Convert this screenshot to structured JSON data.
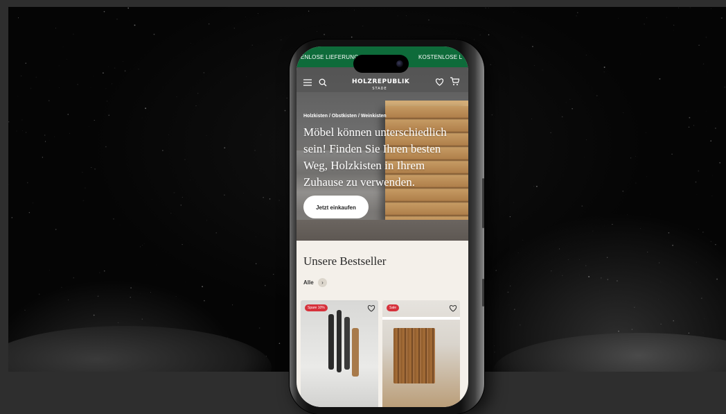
{
  "promo_bar": {
    "left_text": "ENLOSE LIEFERUNG",
    "right_text": "KOSTENLOSE L",
    "color": "#0e6b3a"
  },
  "header": {
    "logo_text": "HOLZREPUBLIK",
    "logo_sub": "STADE",
    "icons": [
      "menu-icon",
      "search-icon",
      "heart-icon",
      "cart-icon"
    ]
  },
  "hero": {
    "breadcrumb": "Holzkisten / Obstkisten / Weinkisten",
    "headline": "Möbel können unterschiedlich sein! Finden Sie Ihren besten Weg, Holzkisten in Ihrem Zuhause zu verwenden.",
    "cta_label": "Jetzt einkaufen"
  },
  "bestsellers": {
    "title": "Unsere Bestseller",
    "all_label": "Alle",
    "products": [
      {
        "badge": "Spare 10%"
      },
      {
        "badge": "Sale"
      }
    ]
  },
  "colors": {
    "badge": "#d6313b",
    "page_background": "#f4f0ea"
  }
}
